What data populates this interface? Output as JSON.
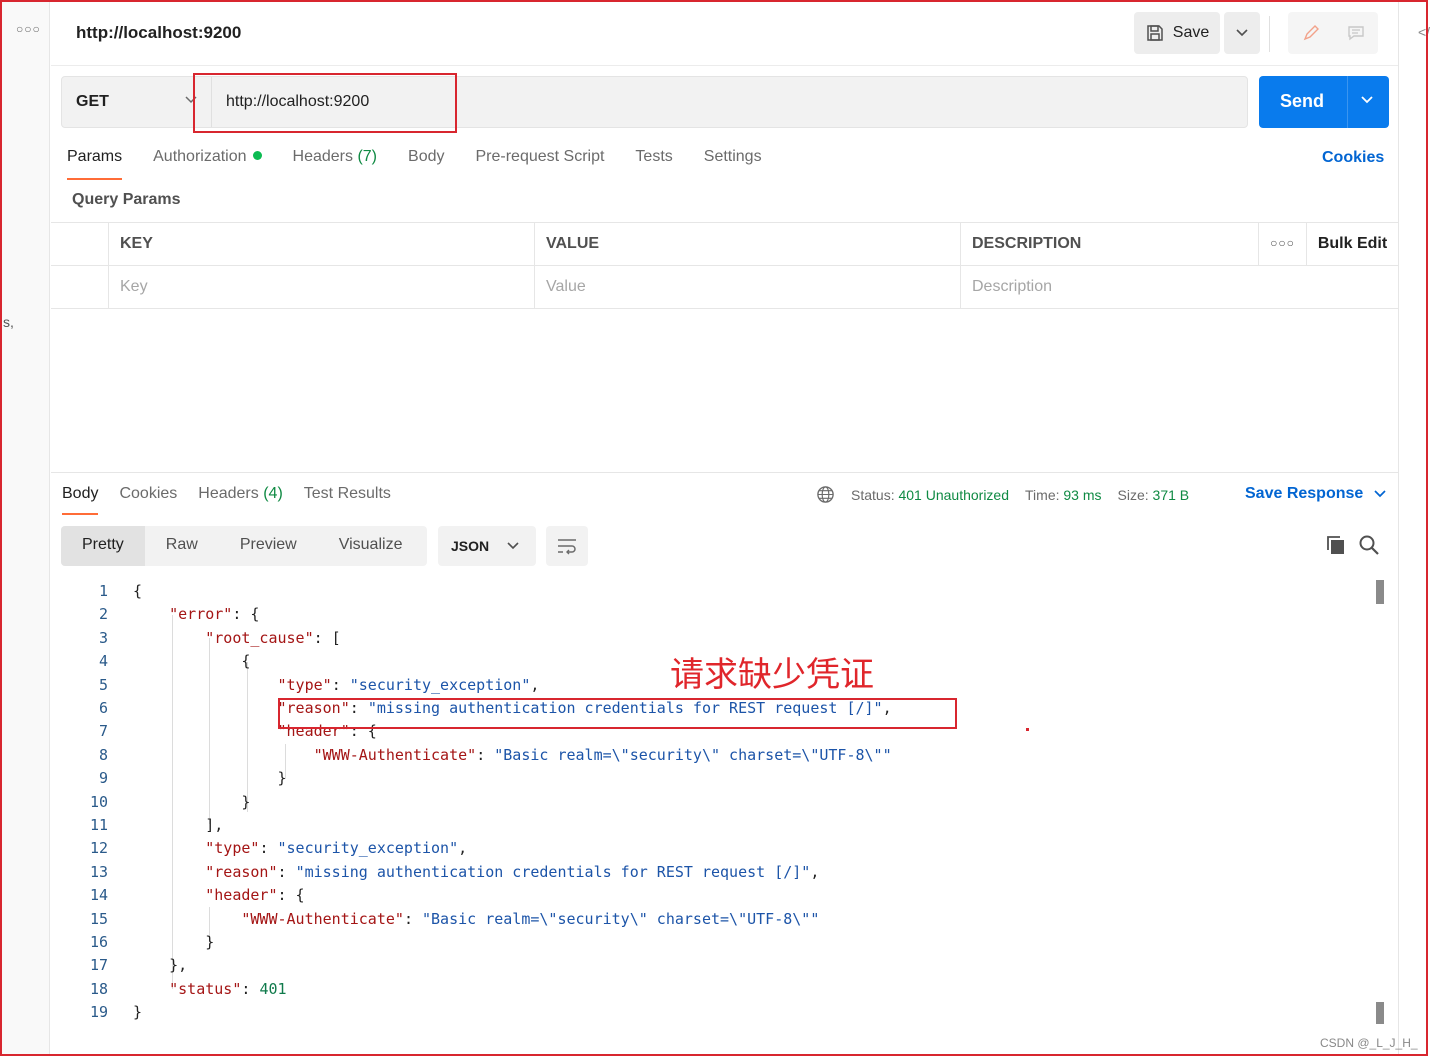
{
  "sidebar": {
    "menu_icon": "more-horizontal-icon",
    "fragment_text": "s,"
  },
  "right_fragment": "</",
  "header": {
    "title": "http://localhost:9200",
    "save_label": "Save"
  },
  "request": {
    "method": "GET",
    "url": "http://localhost:9200",
    "send_label": "Send"
  },
  "tabs": {
    "params": "Params",
    "authorization": "Authorization",
    "headers": "Headers",
    "headers_count": "(7)",
    "body": "Body",
    "prerequest": "Pre-request Script",
    "tests": "Tests",
    "settings": "Settings",
    "cookies": "Cookies"
  },
  "query_params": {
    "title": "Query Params",
    "headers": {
      "key": "KEY",
      "value": "VALUE",
      "description": "DESCRIPTION",
      "bulk_edit": "Bulk Edit"
    },
    "placeholders": {
      "key": "Key",
      "value": "Value",
      "description": "Description"
    }
  },
  "response": {
    "tabs": {
      "body": "Body",
      "cookies": "Cookies",
      "headers": "Headers",
      "headers_count": "(4)",
      "test_results": "Test Results"
    },
    "status_label": "Status:",
    "status_value": "401 Unauthorized",
    "time_label": "Time:",
    "time_value": "93 ms",
    "size_label": "Size:",
    "size_value": "371 B",
    "save_response": "Save Response",
    "views": {
      "pretty": "Pretty",
      "raw": "Raw",
      "preview": "Preview",
      "visualize": "Visualize"
    },
    "format": "JSON",
    "code_lines": [
      [
        "{"
      ],
      [
        "    ",
        {
          "k": "\"error\""
        },
        ": {"
      ],
      [
        "        ",
        {
          "k": "\"root_cause\""
        },
        ": ["
      ],
      [
        "            {"
      ],
      [
        "                ",
        {
          "k": "\"type\""
        },
        ": ",
        {
          "s": "\"security_exception\""
        },
        ","
      ],
      [
        "                ",
        {
          "k": "\"reason\""
        },
        ": ",
        {
          "s": "\"missing authentication credentials for REST request [/]\""
        },
        ","
      ],
      [
        "                ",
        {
          "k": "\"header\""
        },
        ": {"
      ],
      [
        "                    ",
        {
          "k": "\"WWW-Authenticate\""
        },
        ": ",
        {
          "s": "\"Basic realm=\\\"security\\\" charset=\\\"UTF-8\\\"\""
        }
      ],
      [
        "                }"
      ],
      [
        "            }"
      ],
      [
        "        ],"
      ],
      [
        "        ",
        {
          "k": "\"type\""
        },
        ": ",
        {
          "s": "\"security_exception\""
        },
        ","
      ],
      [
        "        ",
        {
          "k": "\"reason\""
        },
        ": ",
        {
          "s": "\"missing authentication credentials for REST request [/]\""
        },
        ","
      ],
      [
        "        ",
        {
          "k": "\"header\""
        },
        ": {"
      ],
      [
        "            ",
        {
          "k": "\"WWW-Authenticate\""
        },
        ": ",
        {
          "s": "\"Basic realm=\\\"security\\\" charset=\\\"UTF-8\\\"\""
        }
      ],
      [
        "        }"
      ],
      [
        "    },"
      ],
      [
        "    ",
        {
          "k": "\"status\""
        },
        ": ",
        {
          "n": "401"
        }
      ],
      [
        "}"
      ]
    ]
  },
  "annotation": {
    "text": "请求缺少凭证"
  },
  "watermark": "CSDN @_L_J_H_",
  "colors": {
    "send": "#097bed",
    "accent_tab": "#ff6c37",
    "status_ok": "#0f8a43",
    "link": "#0265d2",
    "annotation": "#d8262f"
  }
}
